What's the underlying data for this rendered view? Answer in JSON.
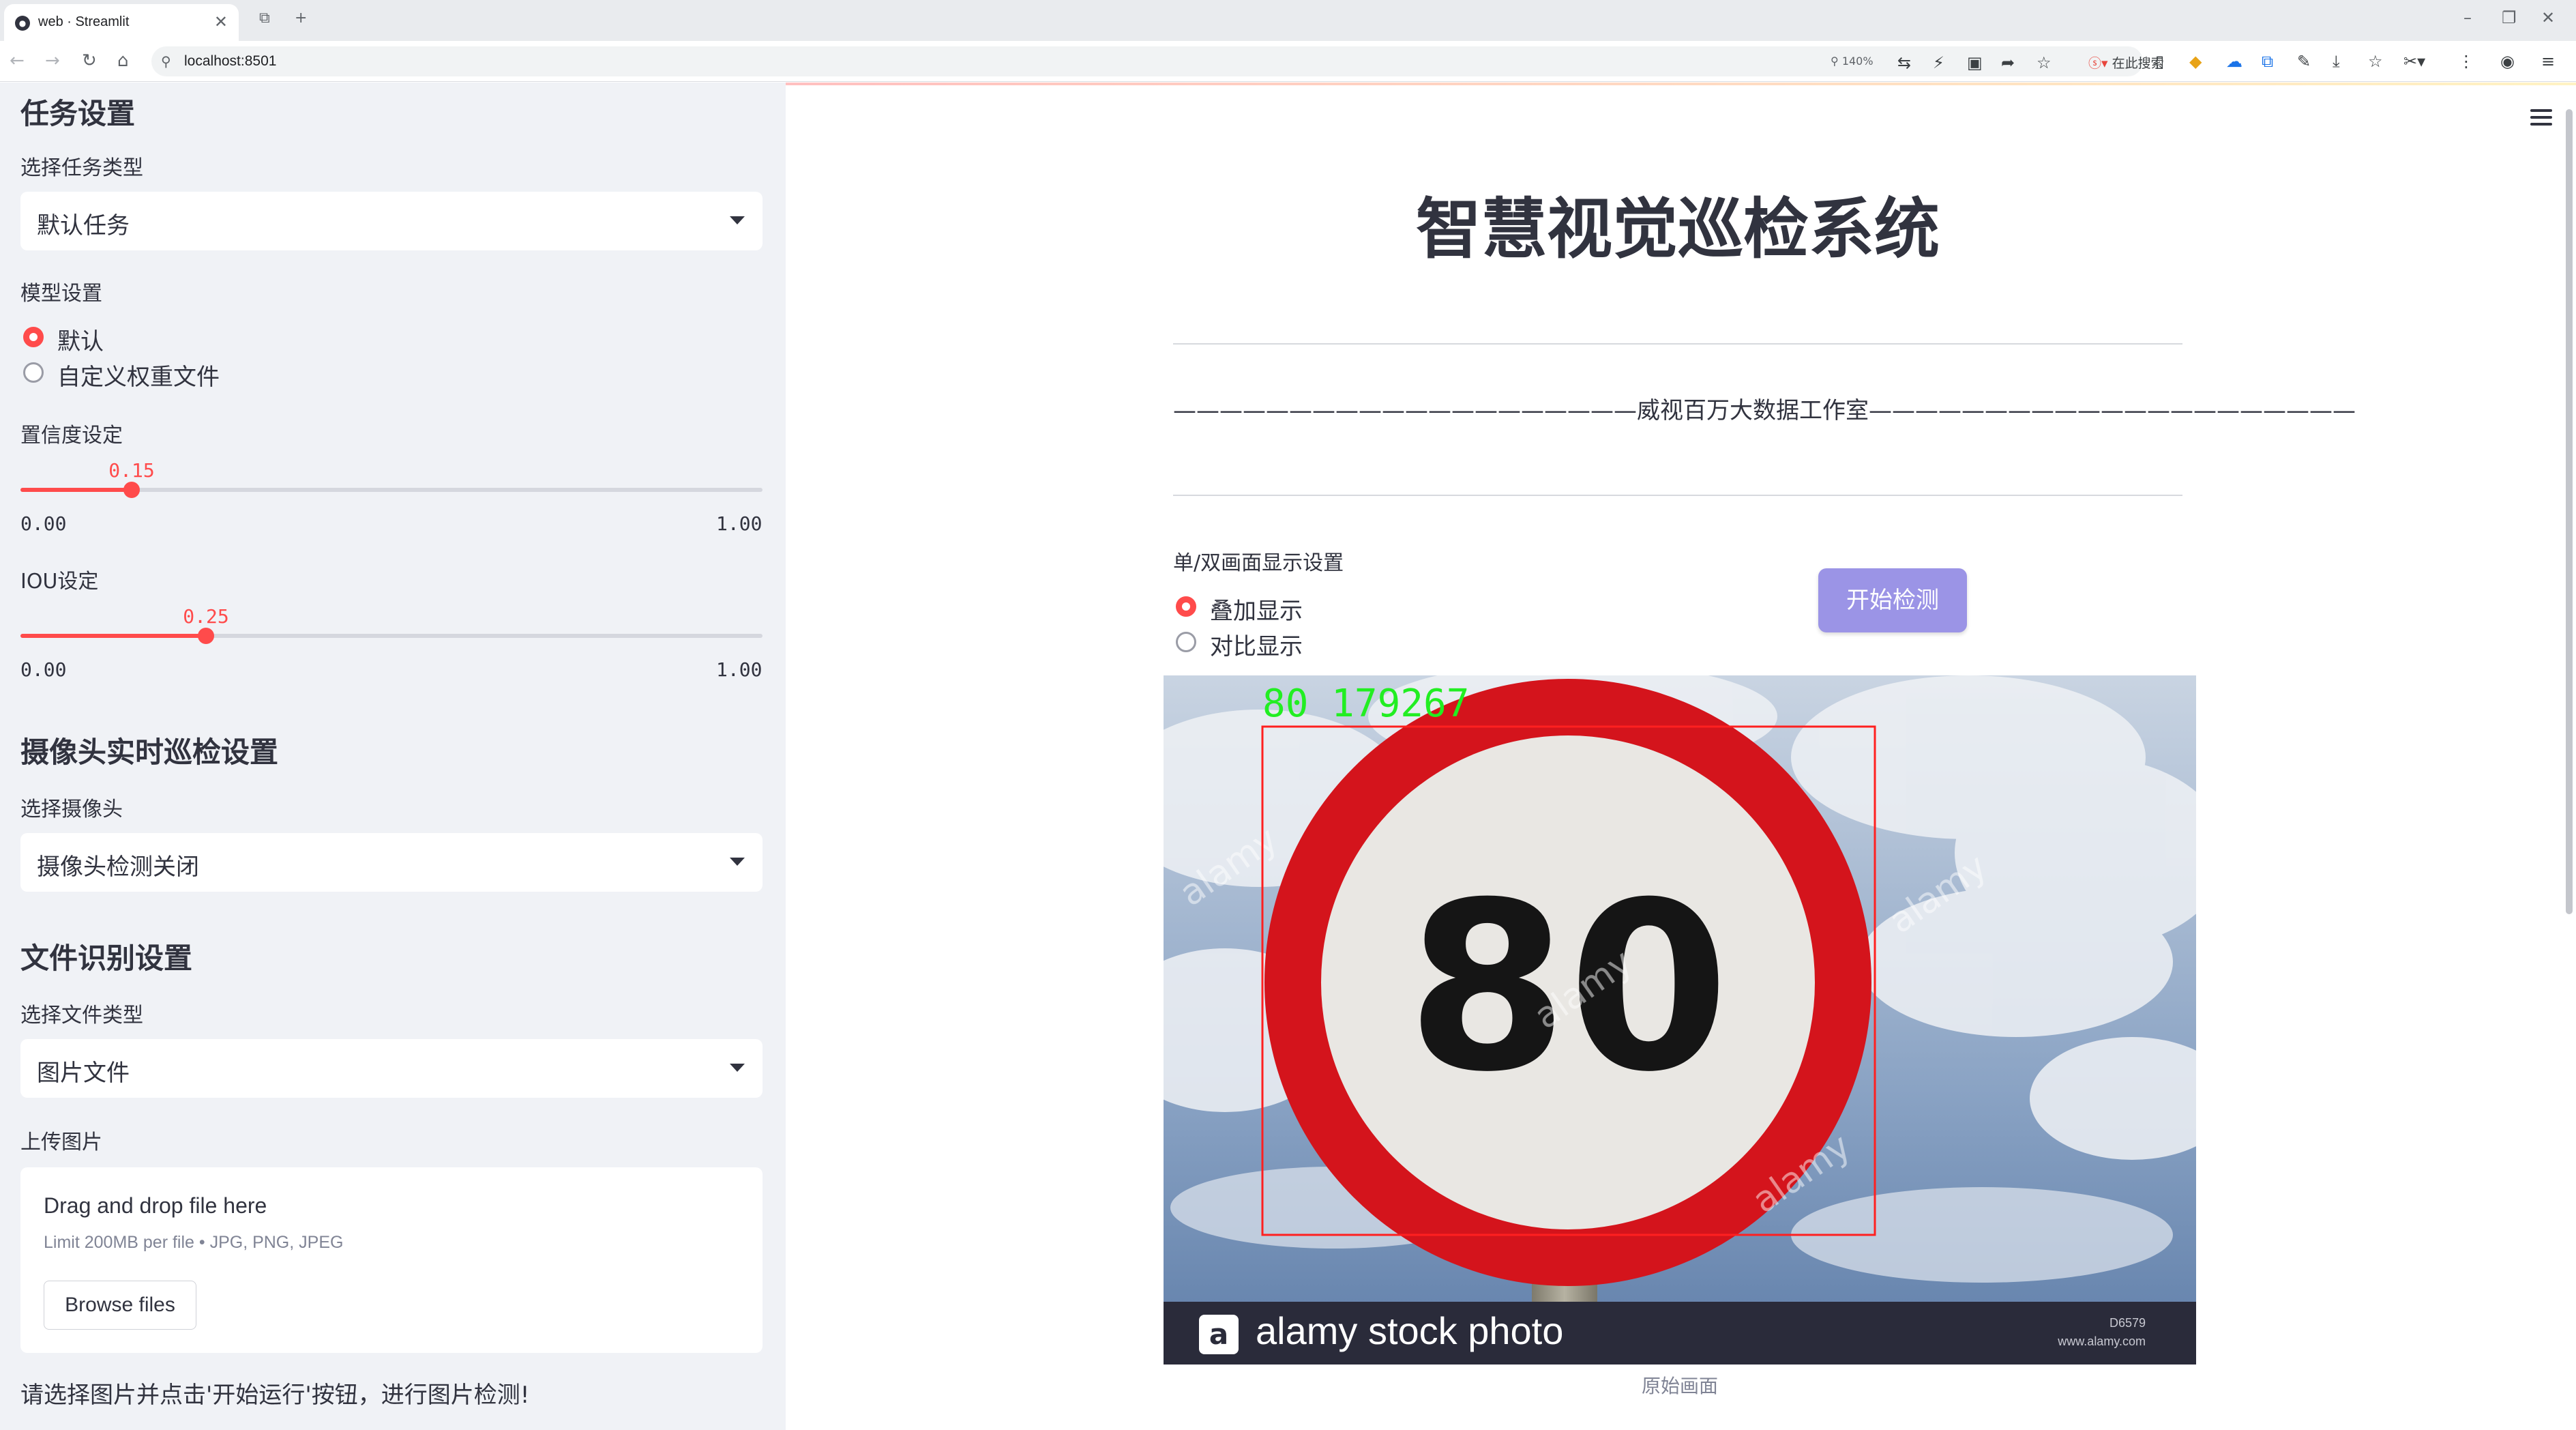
{
  "browser": {
    "tab_title": "web · Streamlit",
    "url": "localhost:8501",
    "zoom": "140%",
    "search_placeholder": "在此搜索"
  },
  "sidebar": {
    "task_section_title": "任务设置",
    "task_type_label": "选择任务类型",
    "task_type_value": "默认任务",
    "model_label": "模型设置",
    "model_options": [
      "默认",
      "自定义权重文件"
    ],
    "model_selected": "默认",
    "confidence_label": "置信度设定",
    "confidence_value": "0.15",
    "confidence_min": "0.00",
    "confidence_max": "1.00",
    "iou_label": "IOU设定",
    "iou_value": "0.25",
    "iou_min": "0.00",
    "iou_max": "1.00",
    "camera_section_title": "摄像头实时巡检设置",
    "camera_label": "选择摄像头",
    "camera_value": "摄像头检测关闭",
    "file_section_title": "文件识别设置",
    "file_type_label": "选择文件类型",
    "file_type_value": "图片文件",
    "upload_label": "上传图片",
    "upload_title": "Drag and drop file here",
    "upload_limit": "Limit 200MB per file • JPG, PNG, JPEG",
    "browse_button": "Browse files",
    "hint": "请选择图片并点击'开始运行'按钮，进行图片检测!"
  },
  "main": {
    "title": "智慧视觉巡检系统",
    "subtitle": "————————————————————威视百万大数据工作室—————————————————————",
    "display_label": "单/双画面显示设置",
    "display_options": [
      "叠加显示",
      "对比显示"
    ],
    "display_selected": "叠加显示",
    "start_button": "开始检测",
    "detection_label": "80  179267",
    "sign_text": "80",
    "watermark": "alamy",
    "stock_banner": "alamy stock photo",
    "stock_id": "D6579",
    "stock_site": "www.alamy.com",
    "caption": "原始画面"
  },
  "colors": {
    "accent": "#ff4b4b",
    "button": "#9b94e6",
    "sidebar_bg": "#f0f2f6",
    "detection_box": "#ff2020",
    "detection_text": "#22ee22"
  }
}
